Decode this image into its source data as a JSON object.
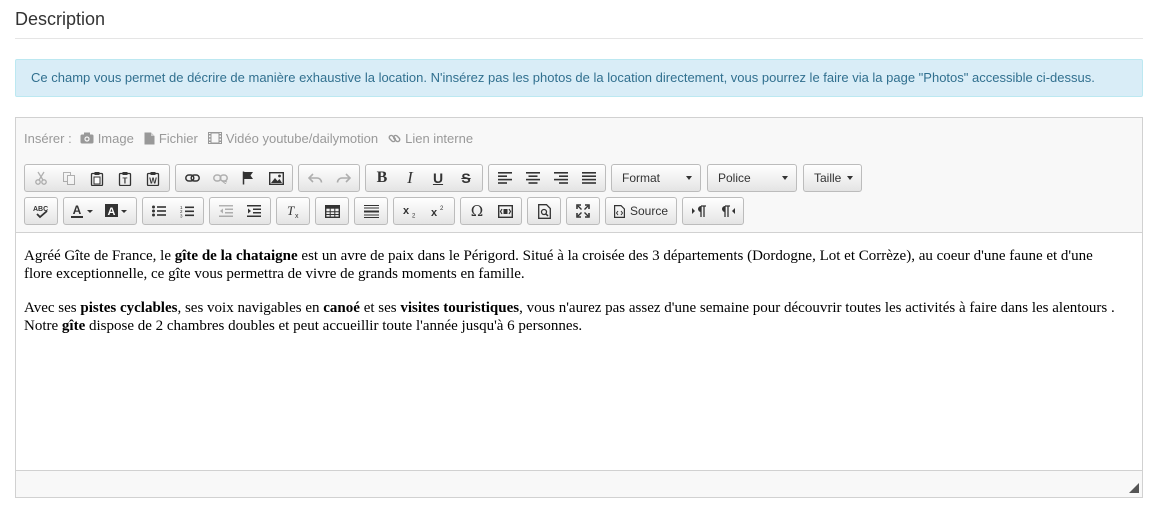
{
  "section": {
    "title": "Description"
  },
  "alert": {
    "text": "Ce champ vous permet de décrire de manière exhaustive la location. N'insérez pas les photos de la location directement, vous pourrez le faire via la page \"Photos\" accessible ci-dessus."
  },
  "editor": {
    "insert_bar": {
      "label": "Insérer :",
      "items": [
        {
          "label": "Image",
          "icon": "camera-icon"
        },
        {
          "label": "Fichier",
          "icon": "file-icon"
        },
        {
          "label": "Vidéo youtube/dailymotion",
          "icon": "film-icon"
        },
        {
          "label": "Lien interne",
          "icon": "link-icon"
        }
      ]
    },
    "toolbar": {
      "format_label": "Format",
      "police_label": "Police",
      "taille_label": "Taille",
      "source_label": "Source",
      "bold_glyph": "B",
      "italic_glyph": "I",
      "underline_glyph": "U",
      "strike_glyph": "S",
      "omega_glyph": "Ω"
    },
    "content": {
      "p1": [
        {
          "text": "Agréé Gîte de France, le ",
          "bold": false
        },
        {
          "text": "gîte de la chataigne",
          "bold": true
        },
        {
          "text": " est un avre de paix dans le Périgord.  Situé à la croisée des 3 départements (Dordogne, Lot et Corrèze), au coeur d'une faune et d'une flore exceptionnelle,  ce gîte vous permettra de vivre de grands moments en famille.",
          "bold": false
        }
      ],
      "p2": [
        {
          "text": "Avec ses ",
          "bold": false
        },
        {
          "text": "pistes cyclables",
          "bold": true
        },
        {
          "text": ", ses voix navigables en ",
          "bold": false
        },
        {
          "text": "canoé",
          "bold": true
        },
        {
          "text": " et ses ",
          "bold": false
        },
        {
          "text": "visites touristiques",
          "bold": true
        },
        {
          "text": ", vous n'aurez pas assez d'une semaine pour découvrir toutes les activités à faire dans les alentours . Notre ",
          "bold": false
        },
        {
          "text": "gîte",
          "bold": true
        },
        {
          "text": " dispose de 2 chambres doubles  et peut accueillir toute l'année jusqu'à 6 personnes.",
          "bold": false
        }
      ]
    }
  },
  "colors": {
    "alert_bg": "#d9edf7",
    "alert_text": "#31708f",
    "toolbar_bg": "#f8f8f8"
  }
}
